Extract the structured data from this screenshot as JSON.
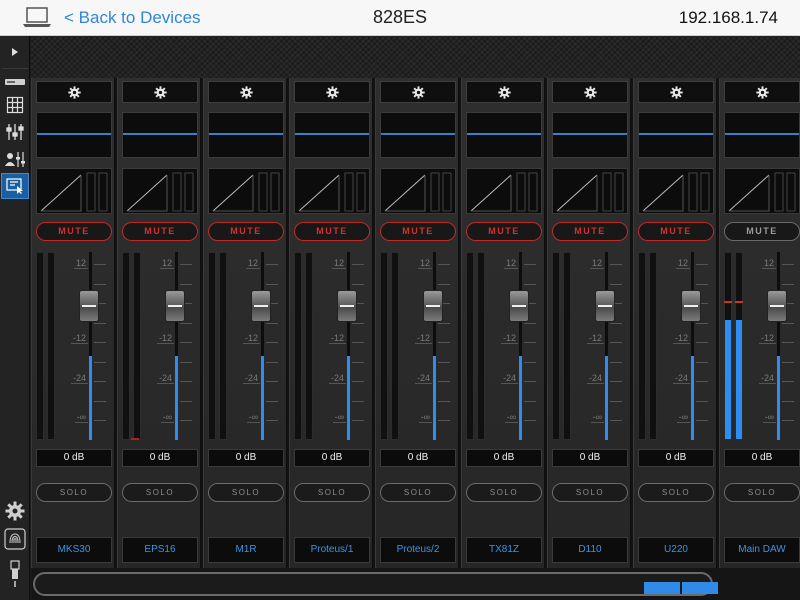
{
  "header": {
    "back_label": "< Back to Devices",
    "title": "828ES",
    "ip": "192.168.1.74"
  },
  "colors": {
    "accent": "#2f86d9",
    "meter": "#2b8ef0",
    "mute": "#d23030"
  },
  "sidebar": {
    "items": [
      {
        "icon": "play-triangle-icon"
      },
      {
        "icon": "device-icon"
      },
      {
        "icon": "grid-icon"
      },
      {
        "icon": "mixer-sliders-icon"
      },
      {
        "icon": "user-sliders-icon"
      },
      {
        "icon": "touch-panel-icon",
        "active": true
      },
      {
        "icon": "settings-icon"
      },
      {
        "icon": "fingerprint-icon"
      },
      {
        "icon": "usb-icon"
      }
    ]
  },
  "scale_labels": [
    "12",
    "0",
    "-12",
    "-24",
    "-∞"
  ],
  "channels": [
    {
      "name": "MKS30",
      "mute_label": "MUTE",
      "solo_label": "SOLO",
      "gain": "0 dB",
      "active_mute": true,
      "meter_level": 0,
      "fader_level": 0.66
    },
    {
      "name": "EPS16",
      "mute_label": "MUTE",
      "solo_label": "SOLO",
      "gain": "0 dB",
      "active_mute": true,
      "meter_level": 0,
      "fader_level": 0.66
    },
    {
      "name": "M1R",
      "mute_label": "MUTE",
      "solo_label": "SOLO",
      "gain": "0 dB",
      "active_mute": true,
      "meter_level": 0,
      "fader_level": 0.66
    },
    {
      "name": "Proteus/1",
      "mute_label": "MUTE",
      "solo_label": "SOLO",
      "gain": "0 dB",
      "active_mute": true,
      "meter_level": 0,
      "fader_level": 0.66
    },
    {
      "name": "Proteus/2",
      "mute_label": "MUTE",
      "solo_label": "SOLO",
      "gain": "0 dB",
      "active_mute": true,
      "meter_level": 0,
      "fader_level": 0.66
    },
    {
      "name": "TX81Z",
      "mute_label": "MUTE",
      "solo_label": "SOLO",
      "gain": "0 dB",
      "active_mute": true,
      "meter_level": 0,
      "fader_level": 0.66
    },
    {
      "name": "D110",
      "mute_label": "MUTE",
      "solo_label": "SOLO",
      "gain": "0 dB",
      "active_mute": true,
      "meter_level": 0,
      "fader_level": 0.66
    },
    {
      "name": "U220",
      "mute_label": "MUTE",
      "solo_label": "SOLO",
      "gain": "0 dB",
      "active_mute": true,
      "meter_level": 0,
      "fader_level": 0.66
    },
    {
      "name": "Main DAW",
      "mute_label": "MUTE",
      "solo_label": "SOLO",
      "gain": "0 dB",
      "active_mute": false,
      "meter_level": 0.64,
      "fader_level": 0.66
    }
  ]
}
